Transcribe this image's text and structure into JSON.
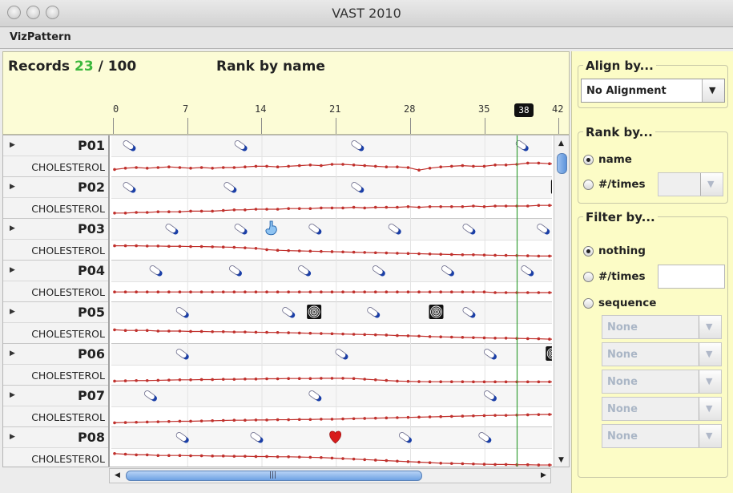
{
  "window": {
    "title": "VAST 2010"
  },
  "menu": {
    "items": [
      "VizPattern"
    ]
  },
  "header": {
    "records_label": "Records",
    "records_count": "23",
    "records_total": "/ 100",
    "rank_caption": "Rank by name"
  },
  "timeline": {
    "ticks": [
      "0",
      "7",
      "14",
      "21",
      "28",
      "35",
      "42"
    ],
    "current": "38"
  },
  "rows": [
    {
      "id": "P01",
      "measure": "CHOLESTEROL"
    },
    {
      "id": "P02",
      "measure": "CHOLESTEROL"
    },
    {
      "id": "P03",
      "measure": "CHOLESTEROL"
    },
    {
      "id": "P04",
      "measure": "CHOLESTEROL"
    },
    {
      "id": "P05",
      "measure": "CHOLESTEROL"
    },
    {
      "id": "P06",
      "measure": "CHOLESTEROL"
    },
    {
      "id": "P07",
      "measure": "CHOLESTEROL"
    },
    {
      "id": "P08",
      "measure": "CHOLESTEROL"
    }
  ],
  "events": [
    [
      {
        "t": 1,
        "icon": "pill"
      },
      {
        "t": 11.5,
        "icon": "pill"
      },
      {
        "t": 22.5,
        "icon": "pill"
      },
      {
        "t": 38,
        "icon": "pill"
      }
    ],
    [
      {
        "t": 1,
        "icon": "pill"
      },
      {
        "t": 10.5,
        "icon": "pill"
      },
      {
        "t": 22.5,
        "icon": "pill"
      },
      {
        "t": 41.5,
        "icon": "spiral"
      }
    ],
    [
      {
        "t": 5,
        "icon": "pill"
      },
      {
        "t": 11.5,
        "icon": "pill"
      },
      {
        "t": 14.5,
        "icon": "stomach"
      },
      {
        "t": 18.5,
        "icon": "pill"
      },
      {
        "t": 26,
        "icon": "pill"
      },
      {
        "t": 33,
        "icon": "pill"
      },
      {
        "t": 40,
        "icon": "pill"
      }
    ],
    [
      {
        "t": 3.5,
        "icon": "pill"
      },
      {
        "t": 11,
        "icon": "pill"
      },
      {
        "t": 17.5,
        "icon": "pill"
      },
      {
        "t": 24.5,
        "icon": "pill"
      },
      {
        "t": 31,
        "icon": "pill"
      },
      {
        "t": 38.5,
        "icon": "pill"
      }
    ],
    [
      {
        "t": 6,
        "icon": "pill"
      },
      {
        "t": 16,
        "icon": "pill"
      },
      {
        "t": 18.5,
        "icon": "spiral"
      },
      {
        "t": 24,
        "icon": "pill"
      },
      {
        "t": 30,
        "icon": "spiral"
      },
      {
        "t": 33,
        "icon": "pill"
      }
    ],
    [
      {
        "t": 6,
        "icon": "pill"
      },
      {
        "t": 21,
        "icon": "pill"
      },
      {
        "t": 35,
        "icon": "pill"
      },
      {
        "t": 41,
        "icon": "spiral"
      }
    ],
    [
      {
        "t": 3,
        "icon": "pill"
      },
      {
        "t": 18.5,
        "icon": "pill"
      },
      {
        "t": 35,
        "icon": "pill"
      }
    ],
    [
      {
        "t": 6,
        "icon": "pill"
      },
      {
        "t": 13,
        "icon": "pill"
      },
      {
        "t": 20.5,
        "icon": "heart"
      },
      {
        "t": 27,
        "icon": "pill"
      },
      {
        "t": 34.5,
        "icon": "pill"
      },
      {
        "t": 41.5,
        "icon": "pill"
      }
    ]
  ],
  "trends": [
    [
      0.35,
      0.45,
      0.5,
      0.45,
      0.5,
      0.55,
      0.5,
      0.45,
      0.5,
      0.45,
      0.5,
      0.5,
      0.55,
      0.6,
      0.6,
      0.55,
      0.6,
      0.65,
      0.7,
      0.65,
      0.75,
      0.75,
      0.7,
      0.65,
      0.6,
      0.55,
      0.55,
      0.5,
      0.3,
      0.45,
      0.55,
      0.6,
      0.65,
      0.6,
      0.6,
      0.7,
      0.7,
      0.75,
      0.85,
      0.85,
      0.8,
      0.75
    ],
    [
      0.2,
      0.2,
      0.25,
      0.25,
      0.3,
      0.3,
      0.3,
      0.35,
      0.35,
      0.35,
      0.4,
      0.45,
      0.45,
      0.5,
      0.5,
      0.5,
      0.55,
      0.55,
      0.55,
      0.6,
      0.6,
      0.6,
      0.65,
      0.6,
      0.65,
      0.65,
      0.65,
      0.7,
      0.65,
      0.7,
      0.7,
      0.7,
      0.7,
      0.75,
      0.7,
      0.75,
      0.75,
      0.75,
      0.75,
      0.8,
      0.8,
      0.8
    ],
    [
      0.9,
      0.9,
      0.9,
      0.88,
      0.88,
      0.86,
      0.86,
      0.84,
      0.84,
      0.82,
      0.8,
      0.78,
      0.74,
      0.7,
      0.6,
      0.55,
      0.52,
      0.5,
      0.48,
      0.46,
      0.44,
      0.42,
      0.4,
      0.38,
      0.36,
      0.34,
      0.32,
      0.3,
      0.28,
      0.26,
      0.24,
      0.22,
      0.2,
      0.2,
      0.18,
      0.16,
      0.15,
      0.14,
      0.12,
      0.1,
      0.1,
      0.1
    ],
    [
      0.55,
      0.55,
      0.55,
      0.55,
      0.55,
      0.55,
      0.55,
      0.55,
      0.55,
      0.55,
      0.55,
      0.55,
      0.55,
      0.55,
      0.55,
      0.55,
      0.55,
      0.55,
      0.55,
      0.55,
      0.55,
      0.55,
      0.55,
      0.55,
      0.55,
      0.55,
      0.55,
      0.55,
      0.55,
      0.55,
      0.55,
      0.55,
      0.55,
      0.55,
      0.55,
      0.5,
      0.5,
      0.5,
      0.5,
      0.5,
      0.5,
      0.5
    ],
    [
      0.85,
      0.8,
      0.8,
      0.8,
      0.75,
      0.75,
      0.75,
      0.72,
      0.72,
      0.7,
      0.7,
      0.68,
      0.68,
      0.66,
      0.65,
      0.64,
      0.62,
      0.6,
      0.58,
      0.56,
      0.54,
      0.52,
      0.5,
      0.48,
      0.46,
      0.44,
      0.4,
      0.38,
      0.36,
      0.32,
      0.3,
      0.28,
      0.26,
      0.24,
      0.22,
      0.2,
      0.2,
      0.18,
      0.16,
      0.15,
      0.12,
      0.1
    ],
    [
      0.1,
      0.12,
      0.14,
      0.14,
      0.16,
      0.18,
      0.2,
      0.2,
      0.22,
      0.22,
      0.24,
      0.24,
      0.26,
      0.26,
      0.28,
      0.28,
      0.3,
      0.3,
      0.3,
      0.32,
      0.32,
      0.32,
      0.3,
      0.25,
      0.2,
      0.15,
      0.1,
      0.08,
      0.06,
      0.05,
      0.05,
      0.05,
      0.05,
      0.04,
      0.04,
      0.04,
      0.04,
      0.04,
      0.04,
      0.04,
      0.04,
      0.04
    ],
    [
      0.1,
      0.12,
      0.14,
      0.16,
      0.18,
      0.2,
      0.22,
      0.22,
      0.24,
      0.26,
      0.28,
      0.3,
      0.3,
      0.32,
      0.32,
      0.34,
      0.34,
      0.36,
      0.36,
      0.38,
      0.38,
      0.4,
      0.42,
      0.44,
      0.46,
      0.48,
      0.5,
      0.52,
      0.54,
      0.56,
      0.58,
      0.6,
      0.62,
      0.64,
      0.66,
      0.68,
      0.68,
      0.7,
      0.72,
      0.74,
      0.75,
      0.75
    ],
    [
      0.95,
      0.9,
      0.85,
      0.85,
      0.8,
      0.8,
      0.8,
      0.78,
      0.78,
      0.76,
      0.76,
      0.74,
      0.74,
      0.72,
      0.72,
      0.7,
      0.7,
      0.68,
      0.66,
      0.64,
      0.6,
      0.56,
      0.52,
      0.48,
      0.44,
      0.4,
      0.36,
      0.32,
      0.28,
      0.24,
      0.2,
      0.18,
      0.16,
      0.14,
      0.12,
      0.1,
      0.1,
      0.08,
      0.08,
      0.06,
      0.06,
      0.06
    ]
  ],
  "colors": {
    "trend": "#c0302c",
    "cursor": "#38a038",
    "highlight_count": "#3db83d",
    "panel_bg": "#fcfcc6"
  },
  "side": {
    "align": {
      "title": "Align by...",
      "value": "No Alignment"
    },
    "rank": {
      "title": "Rank by...",
      "options": [
        "name",
        "#/times"
      ],
      "selected": "name"
    },
    "filter": {
      "title": "Filter by...",
      "options": [
        "nothing",
        "#/times",
        "sequence"
      ],
      "selected": "nothing",
      "sequence_slots": [
        "None",
        "None",
        "None",
        "None",
        "None"
      ]
    }
  }
}
